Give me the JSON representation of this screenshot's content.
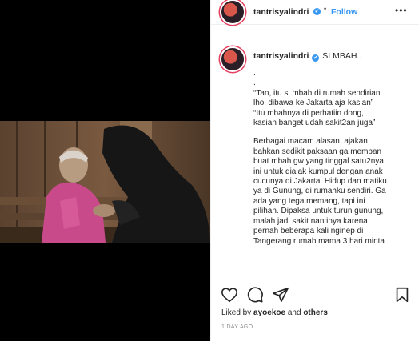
{
  "post": {
    "username": "tantrisyalindri",
    "verified_mark": "✔",
    "follow_label": "Follow",
    "separator": "•",
    "more_label": "•••"
  },
  "caption": {
    "username": "tantrisyalindri",
    "title": "SI MBAH..",
    "dot1": ".",
    "dot2": ".",
    "quote1": "“Tan, itu si mbah di rumah sendirian",
    "quote2": "lhol dibawa ke Jakarta aja kasian”",
    "quote3": "“Itu mbahnya di perhatiin dong,",
    "quote4": "kasian banget udah sakit2an juga”",
    "para1": "Berbagai macam alasan, ajakan,",
    "para2": "bahkan sedikit paksaan ga mempan",
    "para3": "buat mbah gw yang tinggal satu2nya",
    "para4": "ini untuk diajak kumpul dengan anak",
    "para5": "cucunya di Jakarta. Hidup dan matiku",
    "para6": "ya di Gunung, di rumahku sendiri. Ga",
    "para7": "ada yang tega memang, tapi ini",
    "para8": "pilihan. Dipaksa untuk turun gunung,",
    "para9": "malah jadi sakit nantinya karena",
    "para10": "pernah beberapa kali nginep di",
    "para11": "Tangerang rumah mama 3 hari minta"
  },
  "actions": {
    "like_icon": "heart-icon",
    "comment_icon": "comment-icon",
    "share_icon": "share-icon",
    "bookmark_icon": "bookmark-icon"
  },
  "likes": {
    "prefix": "Liked by",
    "user": "ayoekoe",
    "middle": "and",
    "suffix": "others"
  },
  "timestamp": "1 DAY AGO"
}
